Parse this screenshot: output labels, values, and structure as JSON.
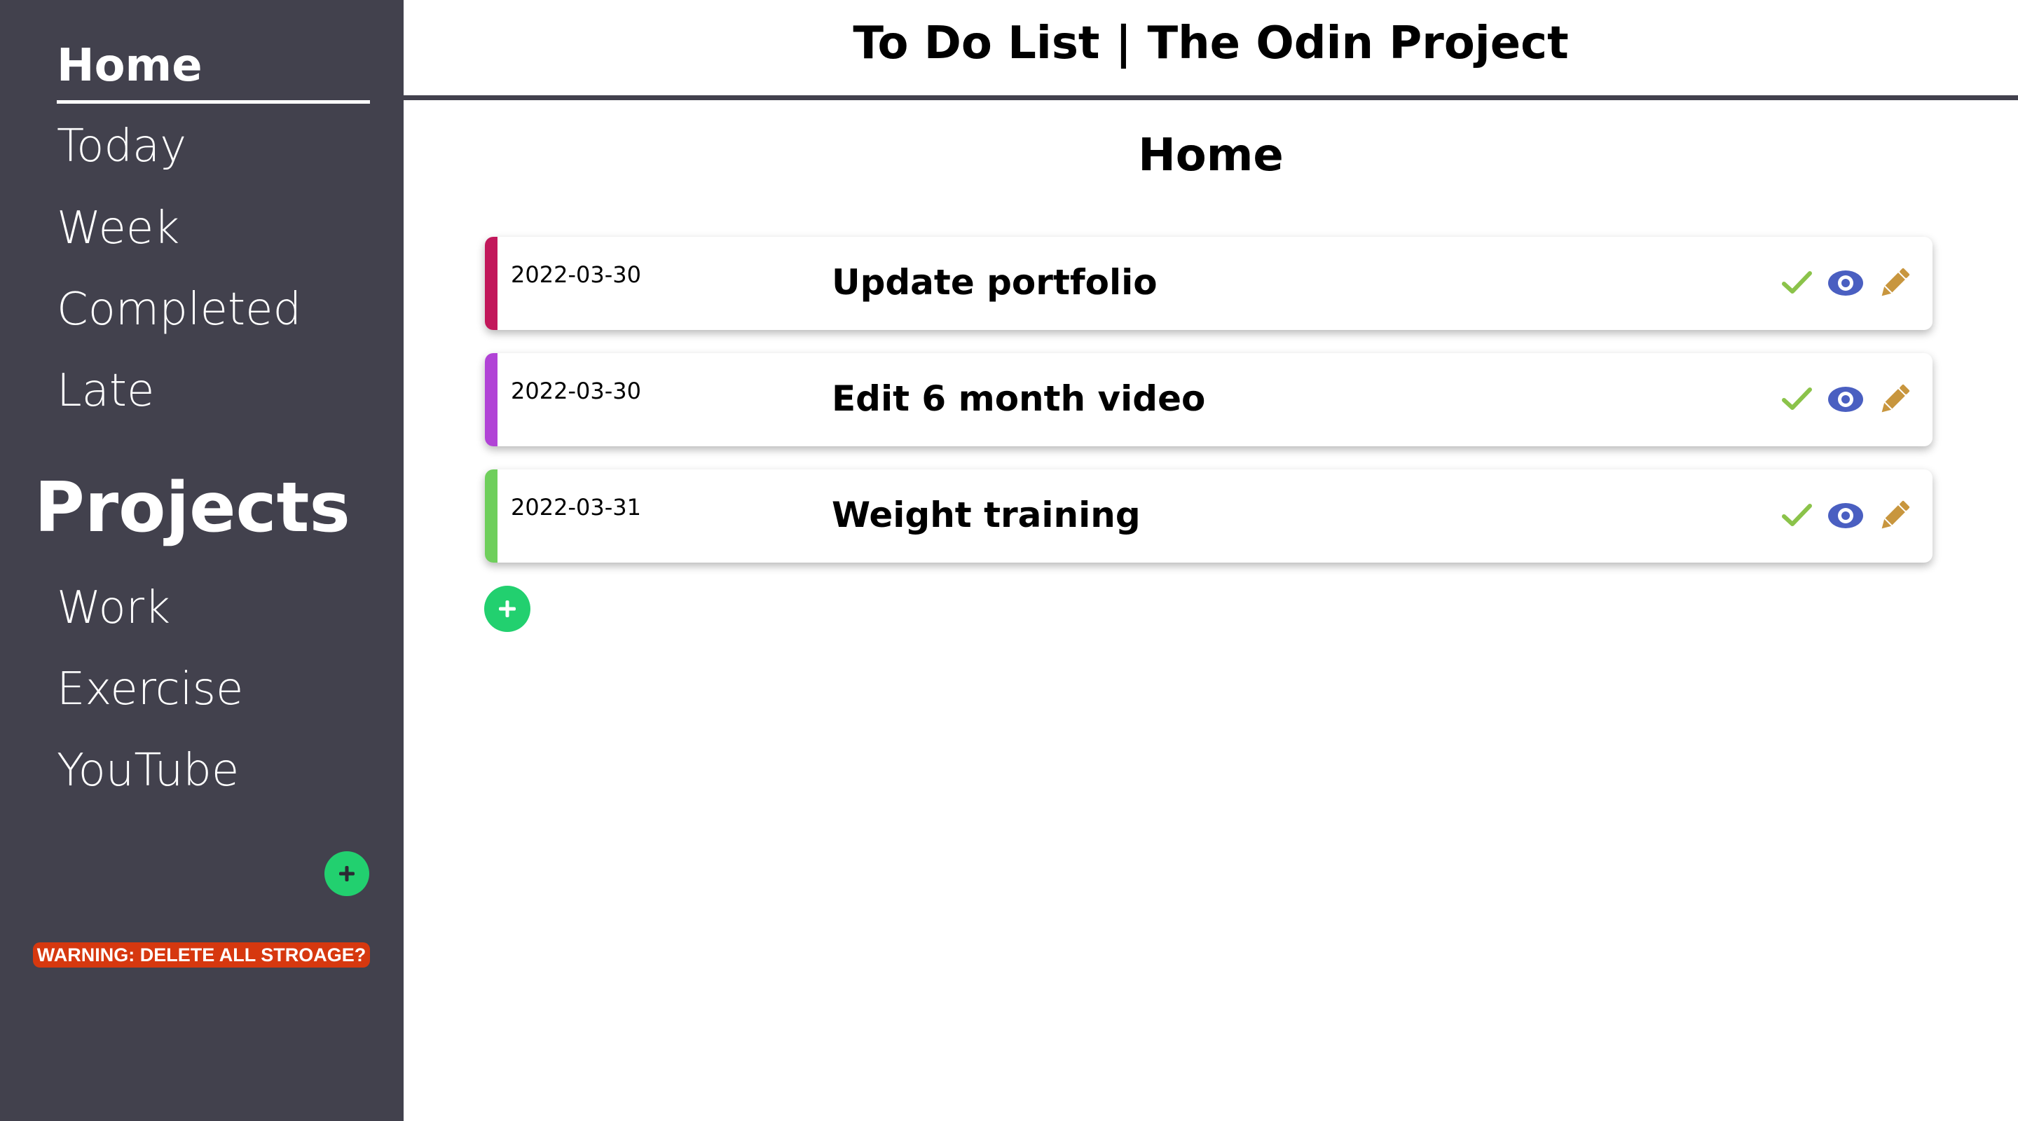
{
  "app": {
    "title": "To Do List | The Odin Project"
  },
  "sidebar": {
    "nav": [
      {
        "label": "Home",
        "active": true
      },
      {
        "label": "Today"
      },
      {
        "label": "Week"
      },
      {
        "label": "Completed"
      },
      {
        "label": "Late"
      }
    ],
    "projects_heading": "Projects",
    "projects": [
      {
        "label": "Work"
      },
      {
        "label": "Exercise"
      },
      {
        "label": "YouTube"
      }
    ],
    "add_project_icon": "plus-circle-icon",
    "warning_label": "WARNING: DELETE ALL STROAGE?"
  },
  "main": {
    "page_title": "Home",
    "tasks": [
      {
        "date": "2022-03-30",
        "title": "Update portfolio",
        "color": "#c2185b"
      },
      {
        "date": "2022-03-30",
        "title": "Edit 6 month video",
        "color": "#b143d6"
      },
      {
        "date": "2022-03-31",
        "title": "Weight training",
        "color": "#6fcf5c"
      }
    ],
    "actions": {
      "complete_icon": "check-icon",
      "view_icon": "eye-icon",
      "edit_icon": "pencil-icon"
    },
    "add_task_icon": "plus-circle-icon"
  },
  "colors": {
    "sidebar_bg": "#42414d",
    "accent_green": "#22d06f",
    "warning_red": "#d6380f",
    "check_green": "#8bc34a",
    "eye_blue": "#4a5fc1",
    "pencil_gold": "#c8963e"
  }
}
